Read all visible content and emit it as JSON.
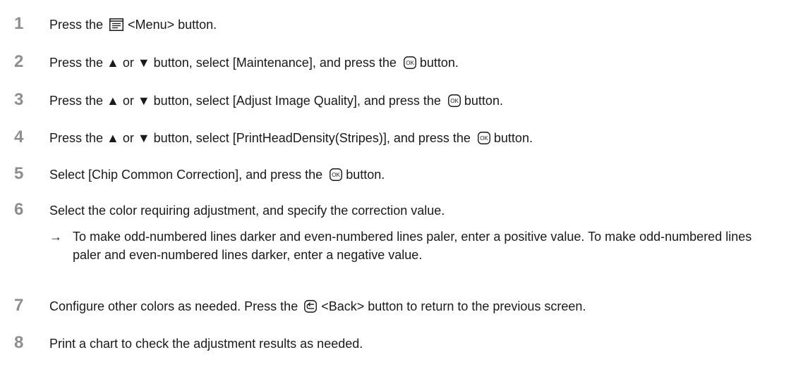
{
  "steps": [
    {
      "number": "1",
      "parts": [
        "Press the ",
        "<Menu> button."
      ],
      "icons": [
        "menu-icon"
      ]
    },
    {
      "number": "2",
      "parts": [
        "Press the ▲ or ▼ button, select [Maintenance], and press the ",
        "button."
      ],
      "icons": [
        "ok-icon"
      ]
    },
    {
      "number": "3",
      "parts": [
        "Press the ▲ or ▼ button, select [Adjust Image Quality], and press the ",
        "button."
      ],
      "icons": [
        "ok-icon"
      ]
    },
    {
      "number": "4",
      "parts": [
        "Press the ▲ or ▼ button, select [PrintHeadDensity(Stripes)], and press the ",
        "button."
      ],
      "icons": [
        "ok-icon"
      ]
    },
    {
      "number": "5",
      "parts": [
        "Select [Chip Common Correction], and press the ",
        "button."
      ],
      "icons": [
        "ok-icon"
      ]
    },
    {
      "number": "6",
      "parts": [
        "Select the color requiring adjustment, and specify the correction value."
      ],
      "icons": []
    },
    {
      "number": "7",
      "parts": [
        "Configure other colors as needed. Press the ",
        "<Back> button to return to the previous screen."
      ],
      "icons": [
        "back-icon"
      ]
    },
    {
      "number": "8",
      "parts": [
        "Print a chart to check the adjustment results as needed."
      ],
      "icons": []
    }
  ],
  "step6_note": {
    "arrow": "→",
    "text": "To make odd-numbered lines darker and even-numbered lines paler, enter a positive value. To make odd-numbered lines paler and even-numbered lines darker, enter a negative value."
  },
  "ok_icon_label": "OK",
  "colors": {
    "step_number": "#8e8e8e",
    "text": "#1a1a1a"
  }
}
